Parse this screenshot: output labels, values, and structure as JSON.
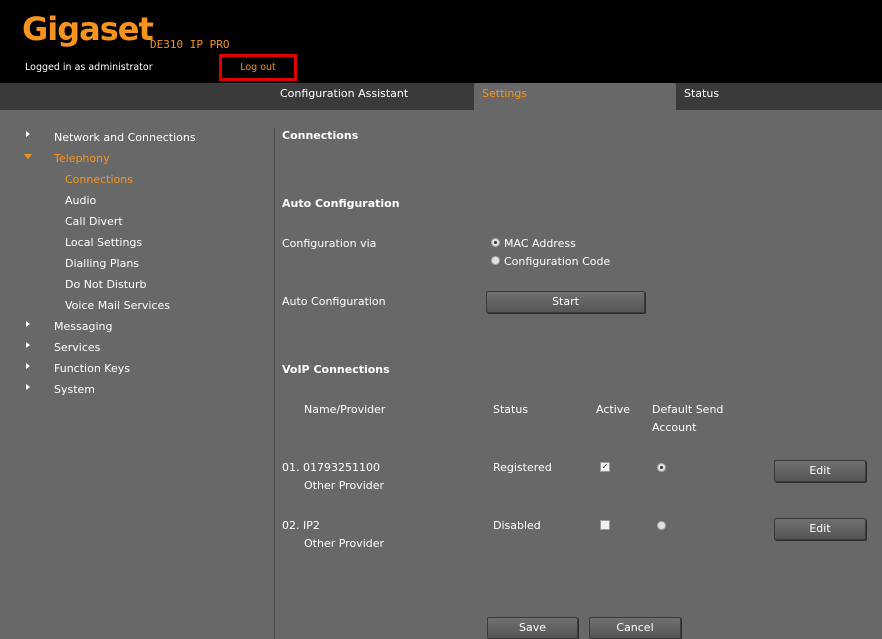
{
  "header": {
    "logo": "Gigaset",
    "model": "DE310 IP PRO",
    "logged_in_text": "Logged in as administrator",
    "logout_label": "Log out"
  },
  "tabs": [
    {
      "label": "Configuration Assistant"
    },
    {
      "label": "Settings",
      "active": true
    },
    {
      "label": "Status"
    }
  ],
  "sidebar": {
    "items": [
      {
        "label": "Network and Connections"
      },
      {
        "label": "Telephony",
        "expanded": true
      },
      {
        "label": "Connections",
        "active": true
      },
      {
        "label": "Audio"
      },
      {
        "label": "Call Divert"
      },
      {
        "label": "Local Settings"
      },
      {
        "label": "Dialling Plans"
      },
      {
        "label": "Do Not Disturb"
      },
      {
        "label": "Voice Mail Services"
      },
      {
        "label": "Messaging"
      },
      {
        "label": "Services"
      },
      {
        "label": "Function Keys"
      },
      {
        "label": "System"
      }
    ]
  },
  "main": {
    "title": "Connections",
    "auto_config": {
      "heading": "Auto Configuration",
      "via_label": "Configuration via",
      "option_mac": "MAC Address",
      "option_code": "Configuration Code",
      "selected": "MAC Address",
      "auto_label": "Auto Configuration",
      "start_label": "Start"
    },
    "voip": {
      "heading": "VoIP Connections",
      "columns": {
        "name": "Name/Provider",
        "status": "Status",
        "active": "Active",
        "default_line1": "Default Send",
        "default_line2": "Account"
      },
      "rows": [
        {
          "number": "01. 01793251100",
          "provider": "Other Provider",
          "status": "Registered",
          "active": true,
          "default": true,
          "edit_label": "Edit"
        },
        {
          "number": "02. IP2",
          "provider": "Other Provider",
          "status": "Disabled",
          "active": false,
          "default": false,
          "edit_label": "Edit"
        }
      ]
    },
    "save_label": "Save",
    "cancel_label": "Cancel"
  },
  "colors": {
    "accent": "#f7941d",
    "background": "#686868",
    "header": "#000000",
    "highlight_box": "#e00000"
  }
}
